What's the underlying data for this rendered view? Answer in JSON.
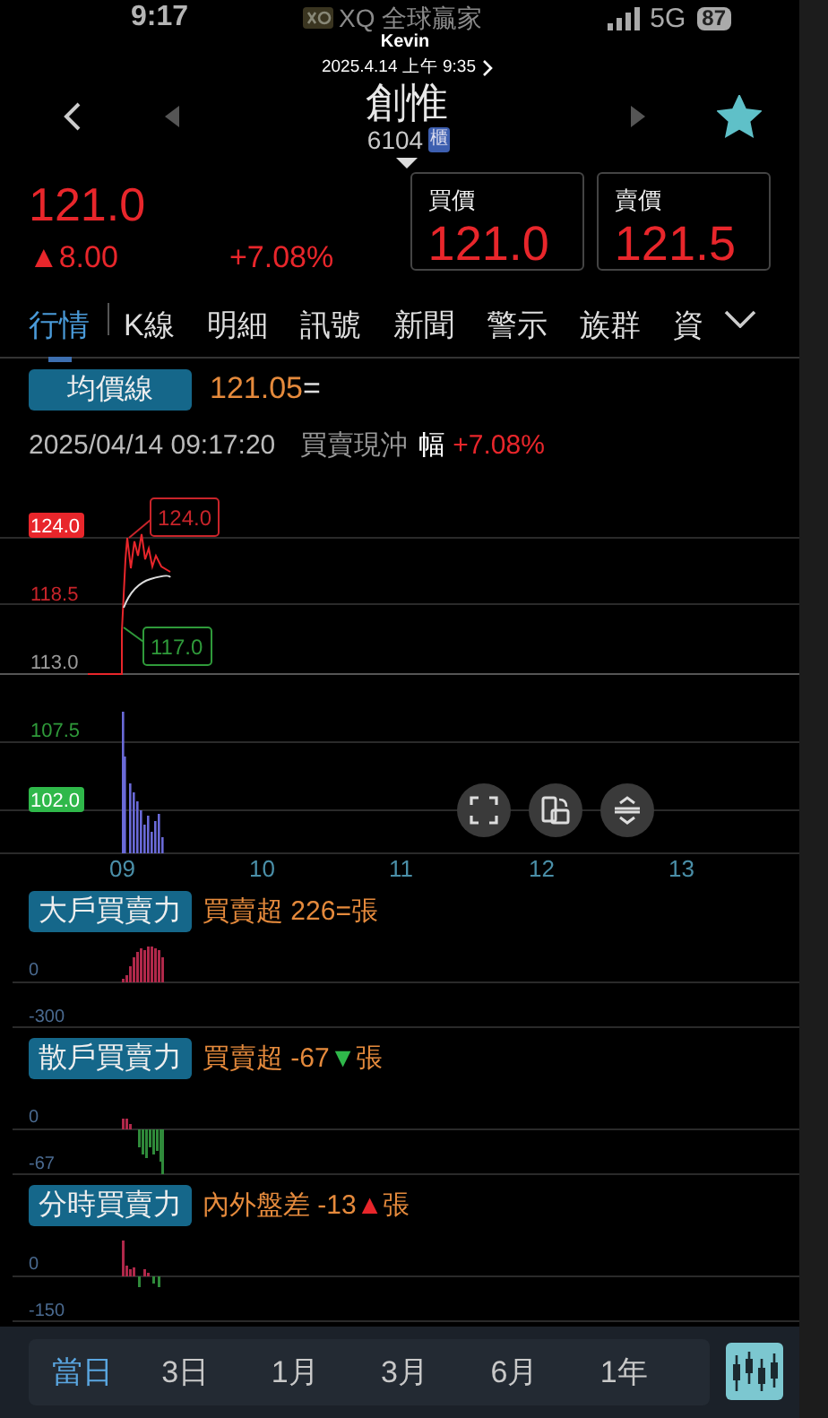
{
  "status_bar": {
    "time": "9:17",
    "app_name": "XQ 全球贏家",
    "network": "5G",
    "battery": "87"
  },
  "notification": {
    "user": "Kevin",
    "timestamp": "2025.4.14 上午 9:35"
  },
  "stock": {
    "name": "創惟",
    "code": "6104",
    "market": "櫃",
    "favorite": true
  },
  "quote": {
    "price": "121.0",
    "change": "▲8.00",
    "change_pct": "+7.08%",
    "bid": {
      "label": "買價",
      "value": "121.0"
    },
    "ask": {
      "label": "賣價",
      "value": "121.5"
    }
  },
  "tabs": [
    {
      "label": "行情",
      "selected": true
    },
    {
      "label": "K線",
      "selected": false
    },
    {
      "label": "明細",
      "selected": false
    },
    {
      "label": "訊號",
      "selected": false
    },
    {
      "label": "新聞",
      "selected": false
    },
    {
      "label": "警示",
      "selected": false
    },
    {
      "label": "族群",
      "selected": false
    },
    {
      "label": "資",
      "selected": false
    }
  ],
  "average_line": {
    "label": "均價線",
    "value": "121.05",
    "sign": "="
  },
  "snapshot": {
    "datetime": "2025/04/14 09:17:20",
    "trade_type": "買賣現沖",
    "range_label": "幅",
    "range_value": "+7.08%"
  },
  "price_chart": {
    "y_labels": [
      {
        "text": "124.0",
        "color": "#e8262b",
        "highlight": true
      },
      {
        "text": "118.5",
        "color": "#c8242a",
        "highlight": false
      },
      {
        "text": "113.0",
        "color": "#9a9a9a",
        "highlight": false
      },
      {
        "text": "107.5",
        "color": "#2f9a3a",
        "highlight": false
      },
      {
        "text": "102.0",
        "color": "#2fb84a",
        "highlight": true
      }
    ],
    "callouts": [
      {
        "text": "124.0",
        "color": "#c8242a"
      },
      {
        "text": "117.0",
        "color": "#2f9a3a"
      }
    ],
    "x_labels": [
      "09",
      "10",
      "11",
      "12",
      "13"
    ]
  },
  "indicators": [
    {
      "tag": "大戶買賣力",
      "label": "買賣超",
      "value": "226",
      "color": "#e58a3c",
      "sign": "=",
      "unit": "張",
      "axis": [
        "0",
        "-300"
      ]
    },
    {
      "tag": "散戶買賣力",
      "label": "買賣超",
      "value": "-67",
      "color": "#2fb84a",
      "sign": "▼",
      "unit": "張",
      "axis": [
        "0",
        "-67"
      ]
    },
    {
      "tag": "分時買賣力",
      "label": "內外盤差",
      "value": "-13",
      "color": "#e8262b",
      "sign": "▲",
      "unit": "張",
      "axis": [
        "0",
        "-150"
      ]
    }
  ],
  "ranges": [
    {
      "label": "當日",
      "selected": true
    },
    {
      "label": "3日",
      "selected": false
    },
    {
      "label": "1月",
      "selected": false
    },
    {
      "label": "3月",
      "selected": false
    },
    {
      "label": "6月",
      "selected": false
    },
    {
      "label": "1年",
      "selected": false
    }
  ]
}
